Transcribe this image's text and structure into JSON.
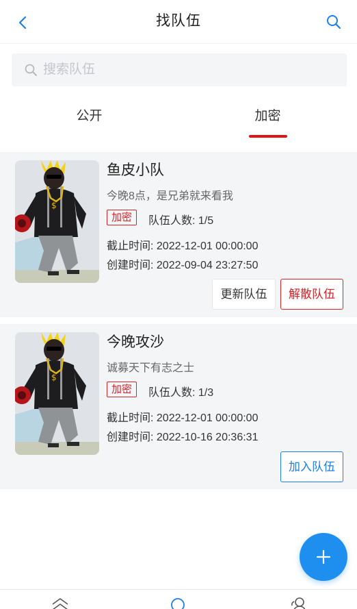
{
  "header": {
    "title": "找队伍",
    "back_icon": "chevron-left-icon",
    "search_icon": "search-icon"
  },
  "search": {
    "placeholder": "搜索队伍",
    "value": ""
  },
  "tabs": [
    {
      "label": "公开",
      "active": false
    },
    {
      "label": "加密",
      "active": true
    }
  ],
  "teams": [
    {
      "name": "鱼皮小队",
      "description": "今晚8点，是兄弟就来看我",
      "badge": "加密",
      "member_count": "队伍人数: 1/5",
      "deadline": "截止时间: 2022-12-01 00:00:00",
      "created": "创建时间: 2022-09-04 23:27:50",
      "buttons": {
        "update": "更新队伍",
        "dissolve": "解散队伍"
      }
    },
    {
      "name": "今晚攻沙",
      "description": "诚募天下有志之士",
      "badge": "加密",
      "member_count": "队伍人数: 1/3",
      "deadline": "截止时间: 2022-12-01 00:00:00",
      "created": "创建时间: 2022-10-16 20:36:31",
      "buttons": {
        "join": "加入队伍"
      }
    }
  ],
  "fab": {
    "icon": "plus-icon"
  },
  "bottom_nav": [
    {
      "icon": "home-icon"
    },
    {
      "icon": "team-icon"
    },
    {
      "icon": "user-icon"
    }
  ],
  "colors": {
    "accent_blue": "#1e8fee",
    "danger_red": "#d8232a",
    "card_bg": "#f4f5f7"
  }
}
